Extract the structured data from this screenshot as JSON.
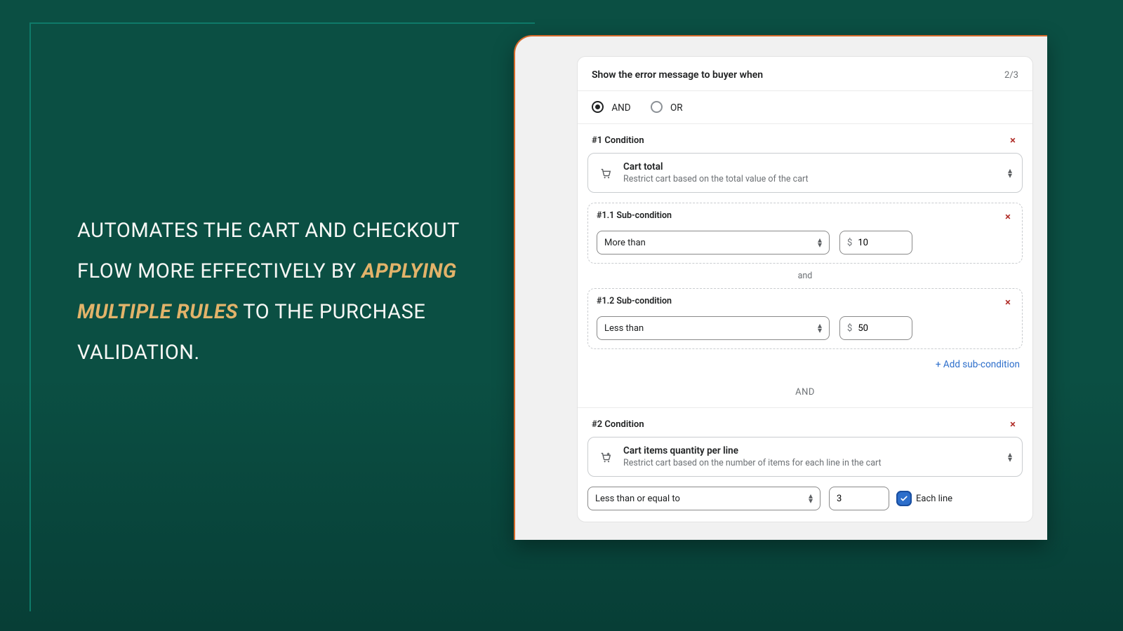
{
  "hero": {
    "pre": "AUTOMATES THE CART AND CHECKOUT FLOW MORE EFFECTIVELY BY ",
    "em": "APPLYING MULTIPLE RULES",
    "post": " TO THE PURCHASE VALIDATION."
  },
  "card": {
    "title": "Show the error message to buyer when",
    "step": "2/3"
  },
  "logic": {
    "and": "AND",
    "or": "OR",
    "selected": "and"
  },
  "cond1": {
    "label": "#1 Condition",
    "picker": {
      "title": "Cart total",
      "sub": "Restrict cart based on the total value of the cart"
    },
    "sub1": {
      "label": "#1.1 Sub-condition",
      "op": "More than",
      "currency": "$",
      "value": "10"
    },
    "joiner": "and",
    "sub2": {
      "label": "#1.2 Sub-condition",
      "op": "Less than",
      "currency": "$",
      "value": "50"
    },
    "addLink": "Add sub-condition"
  },
  "between": "AND",
  "cond2": {
    "label": "#2 Condition",
    "picker": {
      "title": "Cart items quantity per line",
      "sub": "Restrict cart based on the number of items for each line in the cart"
    },
    "op": "Less than or equal to",
    "value": "3",
    "eachLine": "Each line",
    "eachChecked": true
  }
}
